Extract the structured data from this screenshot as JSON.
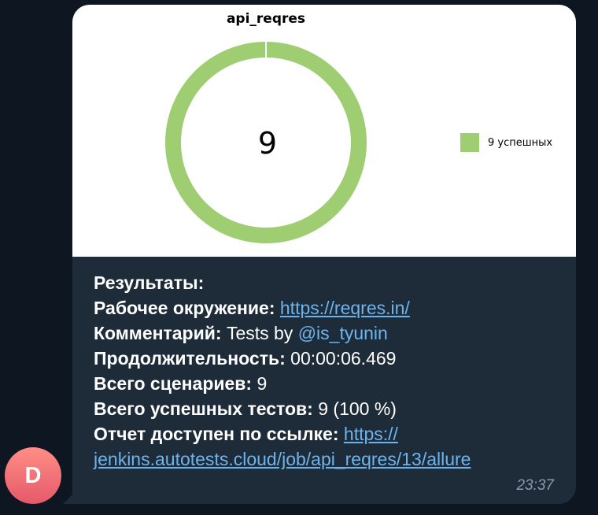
{
  "chart": {
    "title": "api_reqres",
    "center_value": "9",
    "legend_label": "9 успешных",
    "color": "#9fcd71"
  },
  "chart_data": {
    "type": "pie",
    "title": "api_reqres",
    "categories": [
      "9 успешных"
    ],
    "values": [
      9
    ],
    "center_label": "9",
    "legend": "right"
  },
  "message": {
    "results_label": "Результаты:",
    "env_label": "Рабочее окружение:",
    "env_value": "https://reqres.in/",
    "comment_label": "Комментарий:",
    "comment_value": "Tests by",
    "comment_mention": "@is_tyunin",
    "duration_label": "Продолжительность:",
    "duration_value": "00:00:06.469",
    "scenarios_label": "Всего сценариев:",
    "scenarios_value": "9",
    "passed_label": "Всего успешных тестов:",
    "passed_value": "9 (100 %)",
    "report_label": "Отчет доступен по ссылке:",
    "report_link_part1": "https://",
    "report_link_part2": "jenkins.autotests.cloud/job/api_reqres/13/allure",
    "time": "23:37"
  },
  "avatar": {
    "letter": "D",
    "color": "#e96470"
  }
}
